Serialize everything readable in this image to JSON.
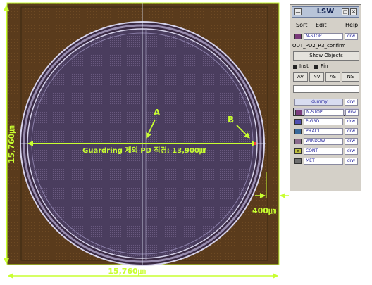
{
  "colors": {
    "canvas_bg": "#5a3b1c",
    "pd_fill": "#4a3d5e",
    "ring_light": "#d6d2ea",
    "ring_mid": "#9a8eb0",
    "annotation": "#c8ff30",
    "crosshair": "#e8f0ff",
    "lsw_bg": "#d4d0c8"
  },
  "annotations": {
    "point_a": "A",
    "point_b": "B",
    "diameter_label": "Guardring 제외 PD 직경: 13,900㎛",
    "dim_vertical": "15,760㎛",
    "dim_horizontal": "15,760㎛",
    "guardring_width": "400㎛"
  },
  "lsw": {
    "title": "LSW",
    "titlebar_buttons": [
      "—",
      "□",
      "✕"
    ],
    "menu": [
      "Sort",
      "Edit",
      "Help"
    ],
    "current_layer": {
      "name": "N-STOP",
      "purpose": "drw",
      "swatch": "#7a3a7a"
    },
    "cell_name": "ODT_PD2_R3_confirm",
    "show_objects": "Show Objects",
    "inst_label": "Inst",
    "pin_label": "Pin",
    "view_buttons": [
      "AV",
      "NV",
      "AS",
      "NS"
    ],
    "filter_value": "",
    "layers": [
      {
        "name": "dummy",
        "purpose": "drw",
        "swatch": ""
      },
      {
        "name": "N-STOP",
        "purpose": "drw",
        "swatch": "#7a3a7a"
      },
      {
        "name": "P-GRD",
        "purpose": "drw",
        "swatch": "#5050b0"
      },
      {
        "name": "P+ACT",
        "purpose": "drw",
        "swatch": "#3a6a9a"
      },
      {
        "name": "WINDOW",
        "purpose": "drw",
        "swatch": "#8a6a8a"
      },
      {
        "name": "CONT",
        "purpose": "drw",
        "swatch": "#c0c040"
      },
      {
        "name": "MET",
        "purpose": "drw",
        "swatch": "#707070"
      }
    ]
  }
}
